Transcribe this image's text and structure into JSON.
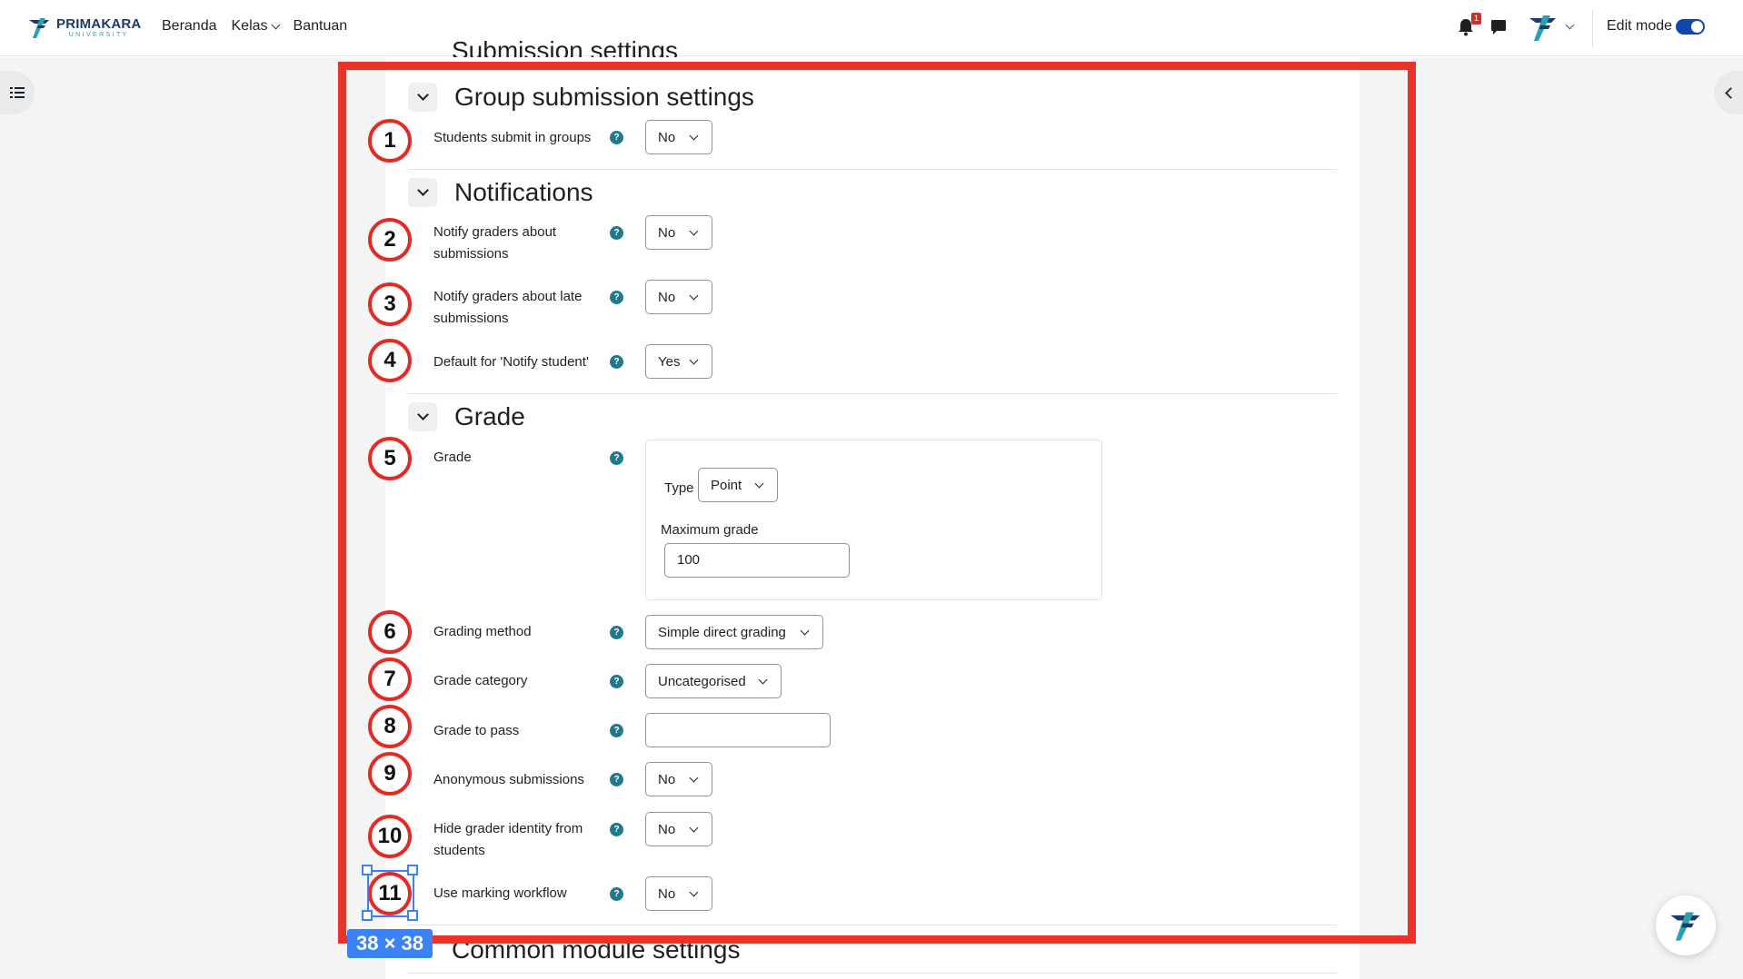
{
  "brand": {
    "name": "PRIMAKARA",
    "sub": "UNIVERSITY"
  },
  "nav": {
    "home": "Beranda",
    "classes": "Kelas",
    "help": "Bantuan"
  },
  "header": {
    "notification_count": "1",
    "edit_mode_label": "Edit mode",
    "edit_mode_on": true
  },
  "sections": {
    "prev_title": "Submission settings",
    "group": {
      "title": "Group submission settings"
    },
    "notifications": {
      "title": "Notifications"
    },
    "grade": {
      "title": "Grade"
    },
    "next_title": "Common module settings"
  },
  "fields": {
    "students_submit_in_groups": {
      "label": "Students submit in groups",
      "value": "No"
    },
    "notify_graders_submissions": {
      "label": "Notify graders about submissions",
      "value": "No"
    },
    "notify_graders_late": {
      "label": "Notify graders about late submissions",
      "value": "No"
    },
    "default_notify_student": {
      "label": "Default for 'Notify student'",
      "value": "Yes"
    },
    "grade": {
      "label": "Grade",
      "type_label": "Type",
      "type_value": "Point",
      "max_label": "Maximum grade",
      "max_value": "100"
    },
    "grading_method": {
      "label": "Grading method",
      "value": "Simple direct grading"
    },
    "grade_category": {
      "label": "Grade category",
      "value": "Uncategorised"
    },
    "grade_to_pass": {
      "label": "Grade to pass",
      "value": ""
    },
    "anonymous_submissions": {
      "label": "Anonymous submissions",
      "value": "No"
    },
    "hide_grader_identity": {
      "label": "Hide grader identity from students",
      "value": "No"
    },
    "use_marking_workflow": {
      "label": "Use marking workflow",
      "value": "No"
    }
  },
  "help_glyph": "?",
  "annotations": {
    "markers": [
      "1",
      "2",
      "3",
      "4",
      "5",
      "6",
      "7",
      "8",
      "9",
      "10",
      "11"
    ],
    "selection_size": "38 × 38",
    "frame_color": "#e8322a",
    "selection_color": "#3b82f6"
  },
  "icons": [
    "list-icon",
    "bell-icon",
    "chat-icon",
    "user-menu-logo-icon",
    "chevron-left-icon",
    "chevron-down-icon",
    "help-icon",
    "brand-logo-icon"
  ]
}
